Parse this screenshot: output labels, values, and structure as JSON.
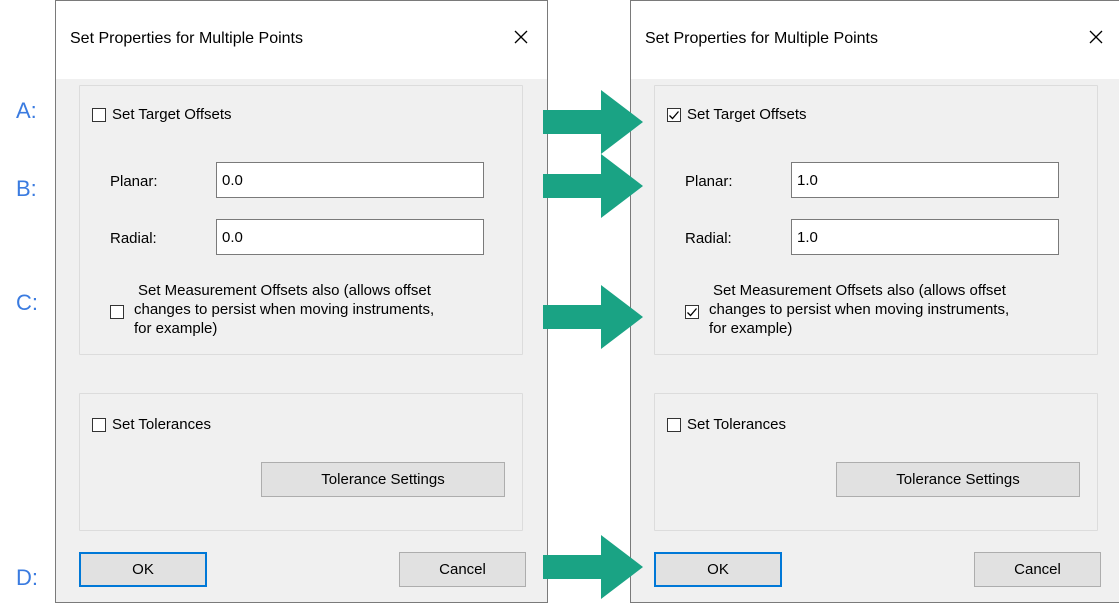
{
  "steps": [
    "A:",
    "B:",
    "C:",
    "D:"
  ],
  "accent_color": "#3a7be0",
  "arrow_color": "#1aa384",
  "dialogs": [
    {
      "title": "Set Properties for Multiple Points",
      "close_icon": "close-icon",
      "target_offsets": {
        "label": "Set Target Offsets",
        "checked": false
      },
      "planar": {
        "label": "Planar:",
        "value": "0.0"
      },
      "radial": {
        "label": "Radial:",
        "value": "0.0"
      },
      "measurement_offsets": {
        "line1": "Set Measurement Offsets also (allows offset",
        "line2": "changes to persist when moving instruments,",
        "line3": "for example)",
        "checked": false
      },
      "tolerances": {
        "label": "Set Tolerances",
        "checked": false
      },
      "tolerance_settings_button": "Tolerance Settings",
      "ok_button": "OK",
      "cancel_button": "Cancel"
    },
    {
      "title": "Set Properties for Multiple Points",
      "close_icon": "close-icon",
      "target_offsets": {
        "label": "Set Target Offsets",
        "checked": true
      },
      "planar": {
        "label": "Planar:",
        "value": "1.0"
      },
      "radial": {
        "label": "Radial:",
        "value": "1.0"
      },
      "measurement_offsets": {
        "line1": "Set Measurement Offsets also (allows offset",
        "line2": "changes to persist when moving instruments,",
        "line3": "for example)",
        "checked": true
      },
      "tolerances": {
        "label": "Set Tolerances",
        "checked": false
      },
      "tolerance_settings_button": "Tolerance Settings",
      "ok_button": "OK",
      "cancel_button": "Cancel"
    }
  ]
}
